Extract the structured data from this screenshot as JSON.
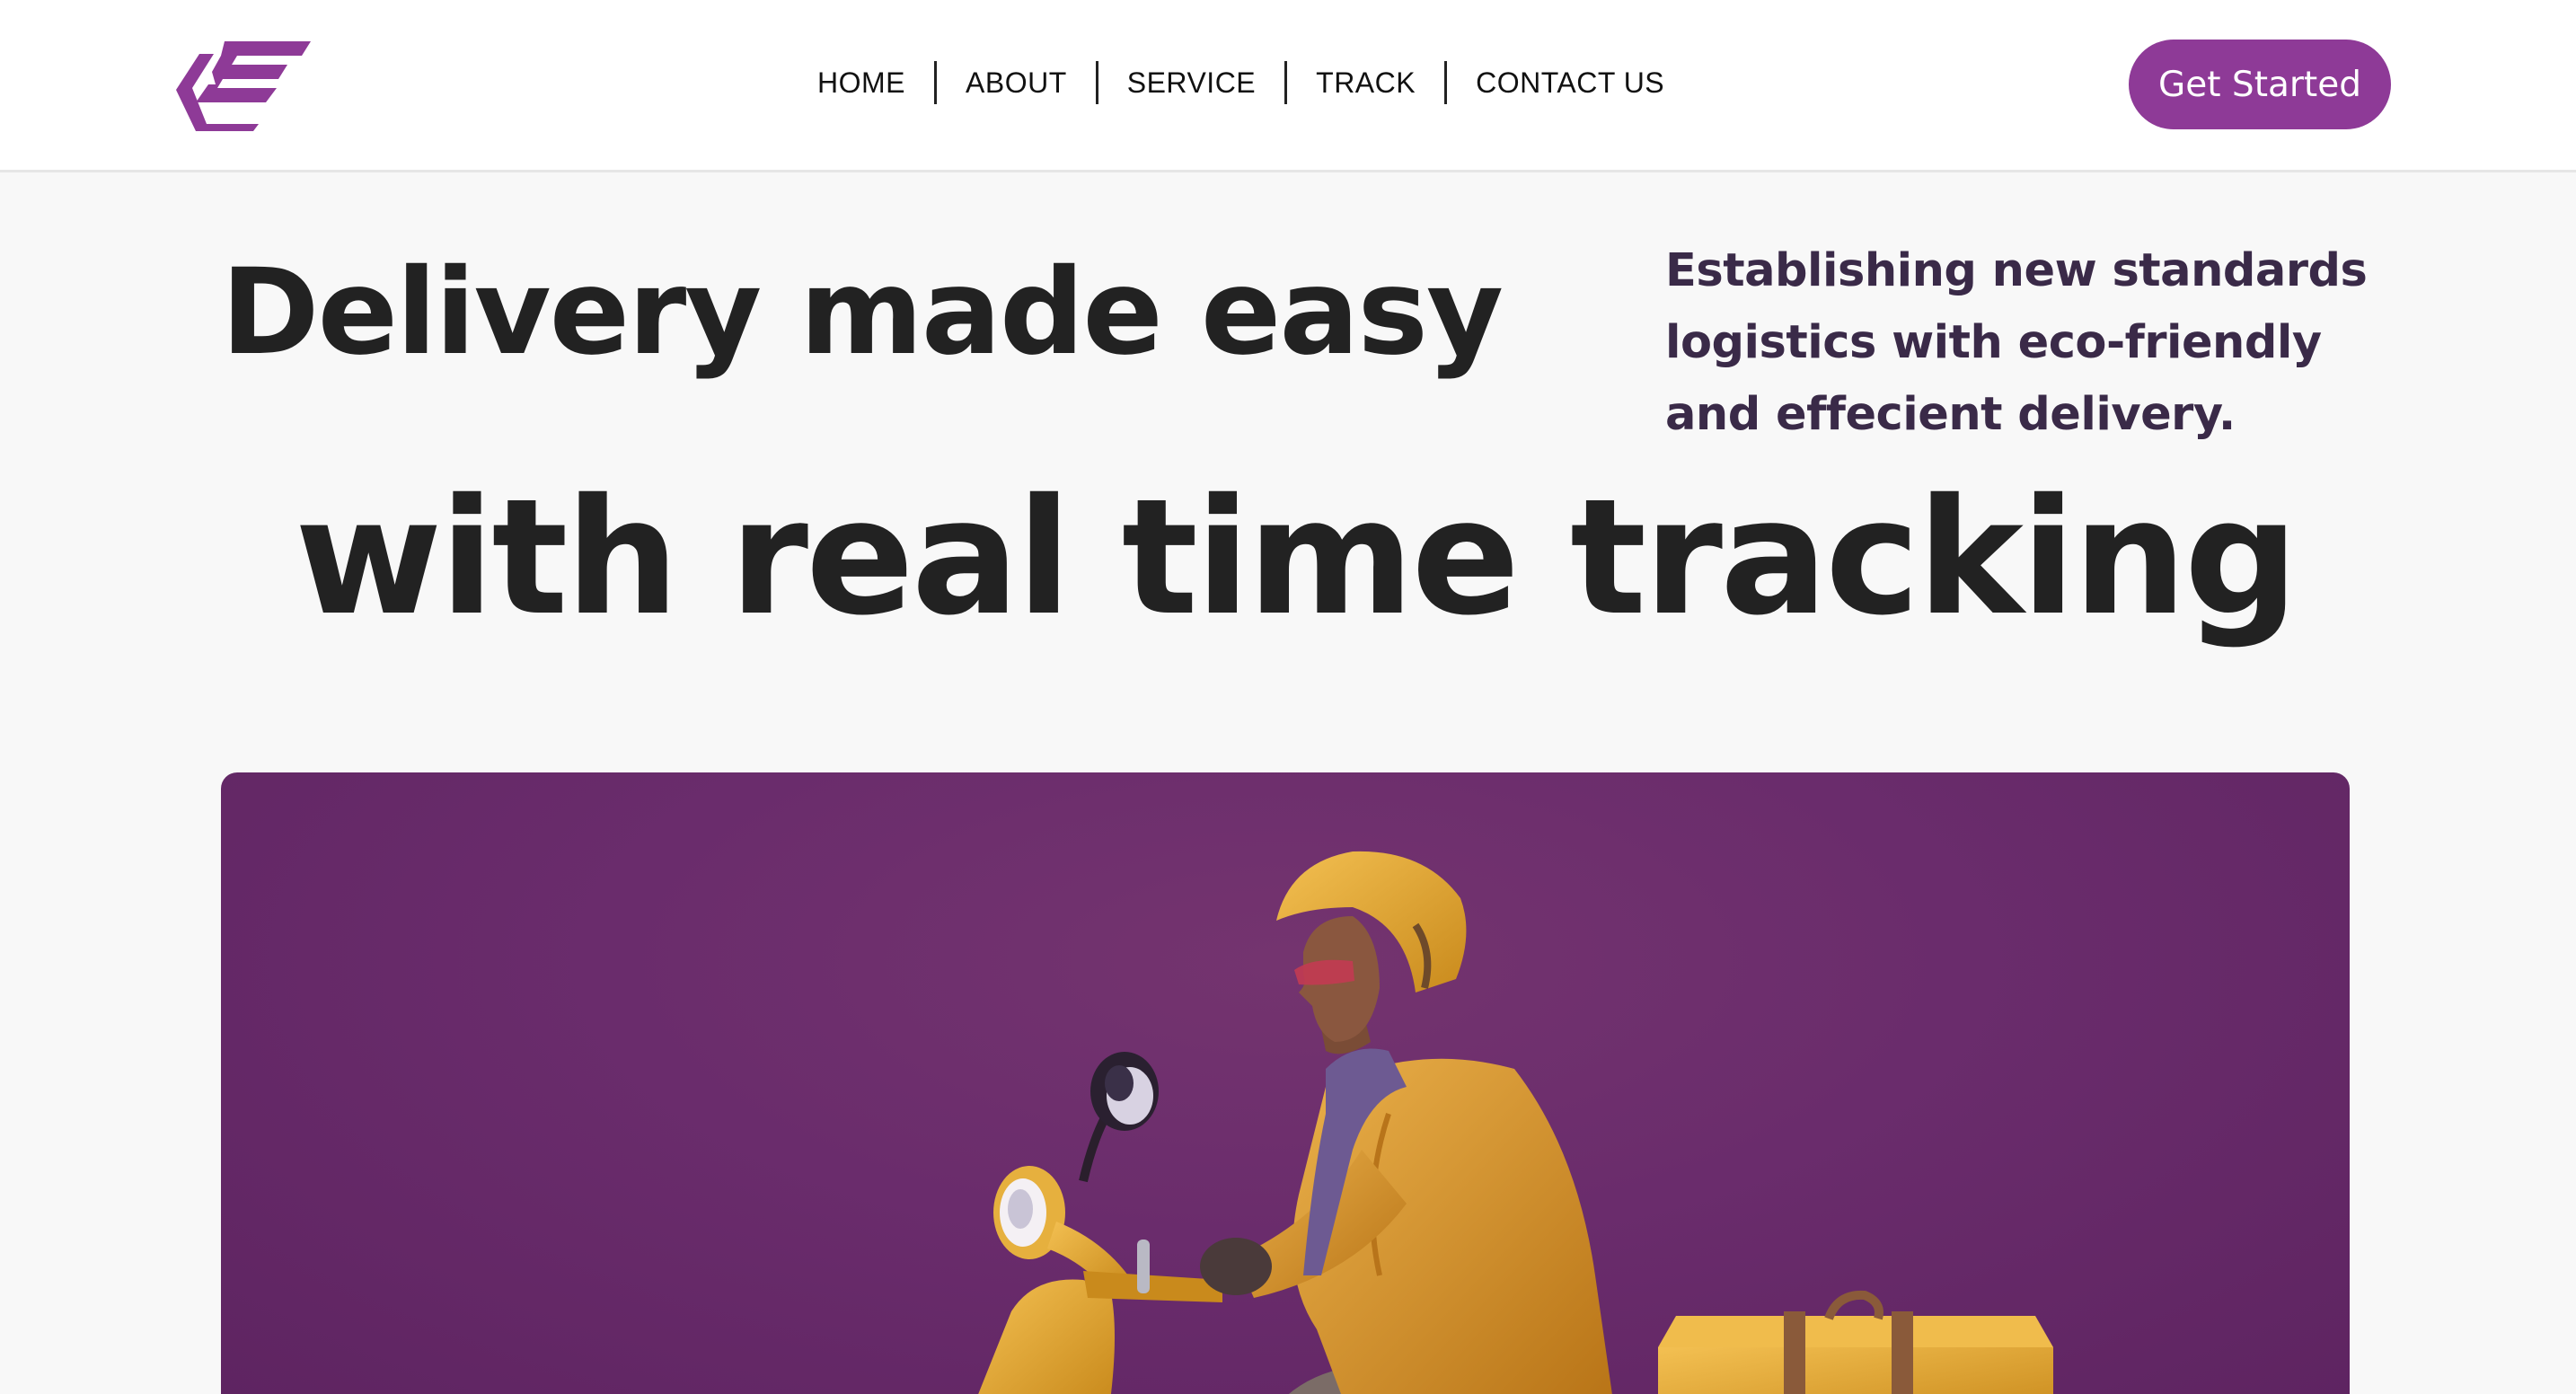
{
  "header": {
    "logo": {
      "icon": "brand-e-logo-icon",
      "color": "#8e3a97"
    },
    "nav": [
      {
        "label": "HOME"
      },
      {
        "label": "ABOUT"
      },
      {
        "label": "SERVICE"
      },
      {
        "label": "TRACK"
      },
      {
        "label": "CONTACT US"
      }
    ],
    "cta_label": "Get Started"
  },
  "hero": {
    "headline_1": "Delivery made easy",
    "headline_2": "with real time tracking",
    "tagline_lines": [
      "Establishing new standards",
      "logistics with eco-friendly",
      "and effecient delivery."
    ],
    "image": {
      "subject": "delivery rider on yellow scooter with parcel box",
      "background_color": "#6a2c6c"
    }
  },
  "colors": {
    "accent": "#8e3a97",
    "text_dark": "#222222",
    "tagline": "#3a2a48",
    "page_bg": "#f8f8f8"
  }
}
